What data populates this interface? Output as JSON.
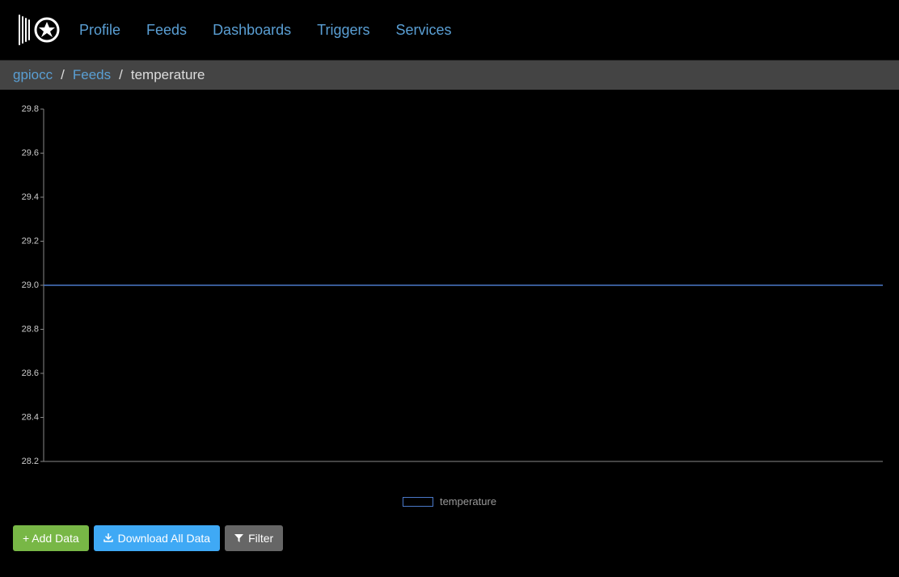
{
  "nav": {
    "links": [
      "Profile",
      "Feeds",
      "Dashboards",
      "Triggers",
      "Services"
    ]
  },
  "breadcrumb": {
    "user": "gpiocc",
    "section": "Feeds",
    "current": "temperature"
  },
  "chart_data": {
    "type": "line",
    "title": "",
    "xlabel": "",
    "ylabel": "",
    "ylim": [
      28.2,
      29.8
    ],
    "y_ticks": [
      29.8,
      29.6,
      29.4,
      29.2,
      29.0,
      28.8,
      28.6,
      28.4,
      28.2
    ],
    "series": [
      {
        "name": "temperature",
        "values": [
          29.0,
          29.0
        ]
      }
    ]
  },
  "buttons": {
    "add_data": "+ Add Data",
    "download_all": "Download All Data",
    "filter": "Filter"
  },
  "legend": {
    "label": "temperature"
  }
}
